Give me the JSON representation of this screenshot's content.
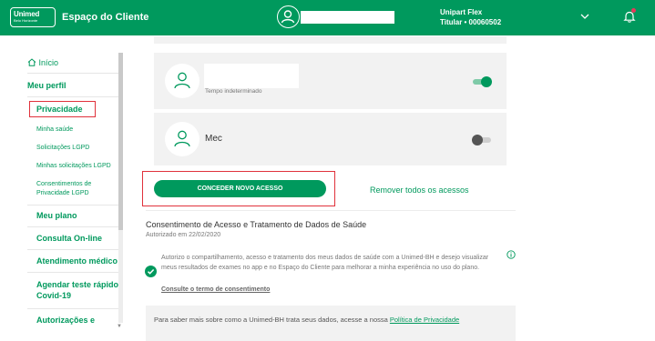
{
  "header": {
    "logo_text": "Unimed",
    "logo_sub": "Belo Horizonte",
    "title": "Espaço do Cliente",
    "plan_name": "Unipart Flex",
    "plan_sub": "Titular • 00060502"
  },
  "sidebar": {
    "items": [
      {
        "label": "Início"
      },
      {
        "label": "Meu perfil"
      },
      {
        "label": "Privacidade"
      },
      {
        "label": "Minha saúde"
      },
      {
        "label": "Solicitações LGPD"
      },
      {
        "label": "Minhas solicitações LGPD"
      },
      {
        "label": "Consentimentos de Privacidade LGPD"
      },
      {
        "label": "Meu plano"
      },
      {
        "label": "Consulta On-line"
      },
      {
        "label": "Atendimento médico"
      },
      {
        "label": "Agendar teste rápido Covid-19"
      },
      {
        "label": "Autorizações e"
      }
    ]
  },
  "access_list": {
    "items": [
      {
        "detail": "Tempo indeterminado",
        "enabled": true
      },
      {
        "name": "Mec",
        "enabled": false
      }
    ],
    "grant_button": "CONCEDER NOVO ACESSO",
    "remove_link": "Remover todos os acessos"
  },
  "consent": {
    "title": "Consentimento de Acesso e Tratamento de Dados de Saúde",
    "date": "Autorizado em 22/02/2020",
    "body": "Autorizo o compartilhamento, acesso e tratamento dos meus dados de saúde com a Unimed-BH e desejo visualizar meus resultados de exames no app e no Espaço do Cliente para melhorar a minha experiência no uso do plano.",
    "term_link": "Consulte o termo de consentimento"
  },
  "info": {
    "text": "Para saber mais sobre como a Unimed-BH trata seus dados, acesse a nossa ",
    "link": "Política de Privacidade"
  },
  "colors": {
    "brand_green": "#00995d",
    "highlight_red": "#e0313b",
    "panel_gray": "#f2f2f2"
  }
}
